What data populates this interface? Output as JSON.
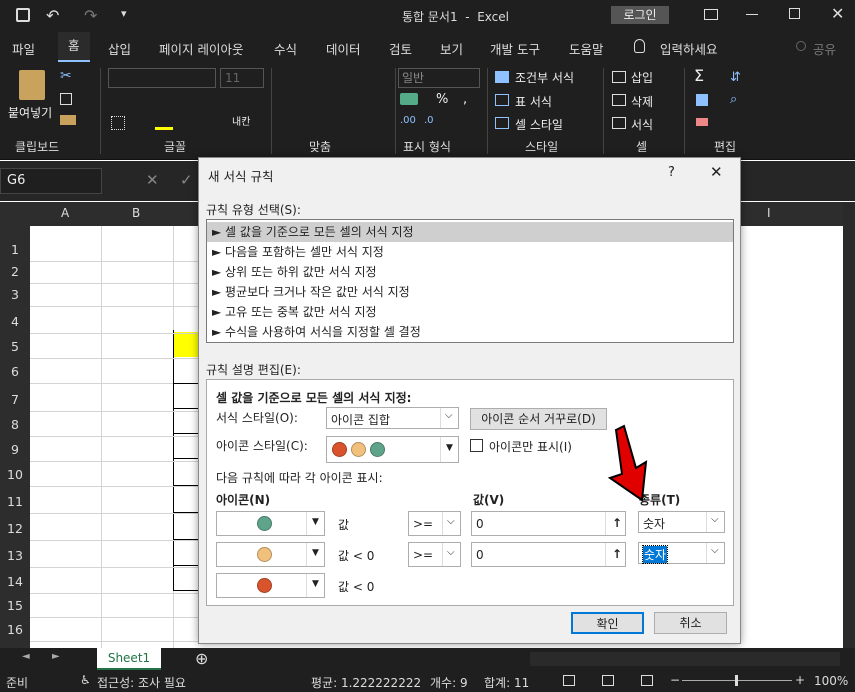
{
  "titlebar": {
    "title": "통합 문서1  -  Excel",
    "login": "로그인"
  },
  "tabs": [
    "파일",
    "홈",
    "삽입",
    "페이지 레이아웃",
    "수식",
    "데이터",
    "검토",
    "보기",
    "개발 도구",
    "도움말",
    "입력하세요",
    "공유"
  ],
  "ribbon": {
    "paste": "붙여넣기",
    "font_size": "11",
    "number_format": "일반",
    "conditional": "조건부 서식",
    "table_format": "표 서식",
    "cell_style": "셀 스타일",
    "insert": "삽입",
    "delete": "삭제",
    "format": "서식",
    "groups": [
      "클립보드",
      "글꼴",
      "맞춤",
      "표시 형식",
      "스타일",
      "셀",
      "편집"
    ],
    "wrap": "내칸"
  },
  "namebox": "G6",
  "columns": [
    "A",
    "B",
    "I"
  ],
  "rows": [
    "1",
    "2",
    "3",
    "4",
    "5",
    "6",
    "7",
    "8",
    "9",
    "10",
    "11",
    "12",
    "13",
    "14",
    "15",
    "16"
  ],
  "sheet_tab": "Sheet1",
  "status": {
    "ready": "준비",
    "access": "접근성: 조사 필요",
    "average": "평균: 1.222222222",
    "count": "개수: 9",
    "sum": "합계: 11",
    "zoom": "100%"
  },
  "dialog": {
    "title": "새 서식 규칙",
    "help": "?",
    "rule_type_label": "규칙 유형 선택(S):",
    "rule_types": [
      "► 셀 값을 기준으로 모든 셀의 서식 지정",
      "► 다음을 포함하는 셀만 서식 지정",
      "► 상위 또는 하위 값만 서식 지정",
      "► 평균보다 크거나 작은 값만 서식 지정",
      "► 고유 또는 중복 값만 서식 지정",
      "► 수식을 사용하여 서식을 지정할 셀 결정"
    ],
    "edit_label": "규칙 설명 편집(E):",
    "edit_heading": "셀 값을 기준으로 모든 셀의 서식 지정:",
    "format_style_label": "서식 스타일(O):",
    "format_style_value": "아이콘 집합",
    "reverse_button": "아이콘 순서 거꾸로(D)",
    "icon_style_label": "아이콘 스타일(C):",
    "icon_only_label": "아이콘만 표시(I)",
    "rules_caption": "다음 규칙에 따라 각 아이콘 표시:",
    "col_icon": "아이콘(N)",
    "col_value": "값(V)",
    "col_type": "종류(T)",
    "rows": [
      {
        "color": "#5fa48a",
        "cond": "값",
        "op": ">=",
        "value": "0",
        "type": "숫자"
      },
      {
        "color": "#f0c07c",
        "cond": "값 < 0",
        "op": ">=",
        "value": "0",
        "type": "숫자"
      },
      {
        "color": "#d9542c",
        "cond": "값 < 0"
      }
    ],
    "ok": "확인",
    "cancel": "취소"
  },
  "colors": {
    "yellow_cell": "#ffff00",
    "arrow": "#e00000"
  }
}
